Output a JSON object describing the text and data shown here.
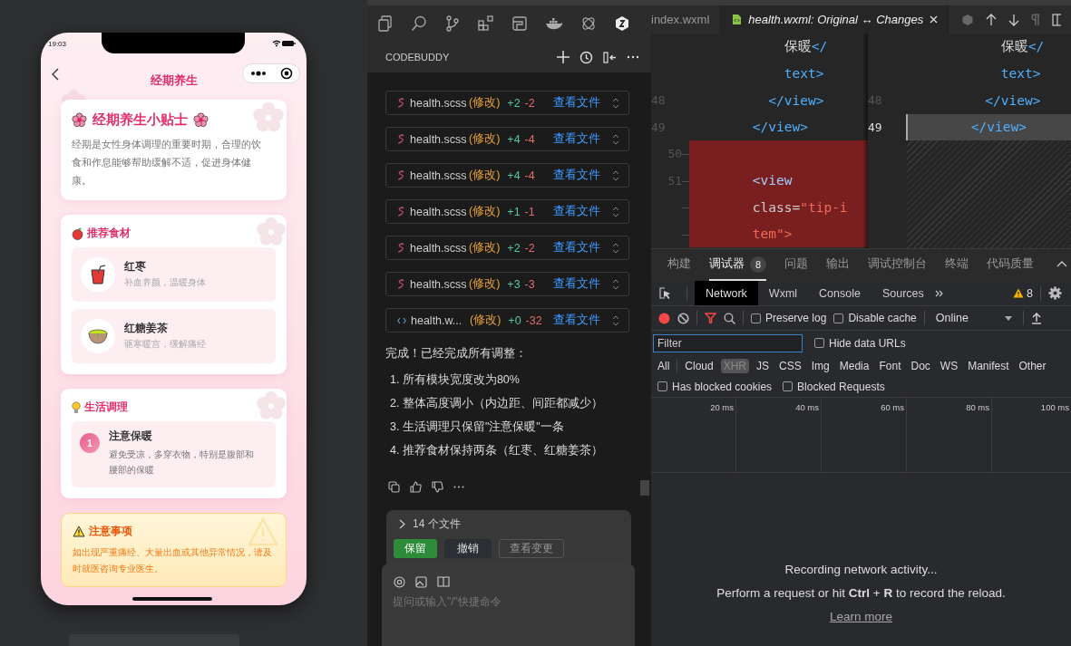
{
  "simulator": {
    "time": "19:03",
    "nav_title": "经期养生",
    "intro": {
      "title": "经期养生小贴士",
      "text": "经期是女性身体调理的重要时期，合理的饮食和作息能够帮助缓解不适，促进身体健康。"
    },
    "foods": {
      "title": "推荐食材",
      "items": [
        {
          "kind": "drink",
          "name": "红枣",
          "desc": "补血养颜，温暖身体"
        },
        {
          "kind": "tea",
          "name": "红糖姜茶",
          "desc": "驱寒暖宫，缓解痛经"
        }
      ]
    },
    "lifestyle": {
      "title": "生活调理",
      "items": [
        {
          "number": "1",
          "name": "注意保暖",
          "desc": "避免受凉，多穿衣物，特别是腹部和腰部的保暖"
        }
      ]
    },
    "notice": {
      "title": "注意事项",
      "text": "如出现严重痛经、大量出血或其他异常情况，请及时就医咨询专业医生。"
    }
  },
  "codebuddy": {
    "title": "CODEBUDDY",
    "files": [
      {
        "kind": "scss",
        "name": "health.scss",
        "status": "(修改)",
        "added": "+2",
        "removed": "-2",
        "action": "查看文件"
      },
      {
        "kind": "scss",
        "name": "health.scss",
        "status": "(修改)",
        "added": "+4",
        "removed": "-4",
        "action": "查看文件"
      },
      {
        "kind": "scss",
        "name": "health.scss",
        "status": "(修改)",
        "added": "+4",
        "removed": "-4",
        "action": "查看文件"
      },
      {
        "kind": "scss",
        "name": "health.scss",
        "status": "(修改)",
        "added": "+1",
        "removed": "-1",
        "action": "查看文件"
      },
      {
        "kind": "scss",
        "name": "health.scss",
        "status": "(修改)",
        "added": "+2",
        "removed": "-2",
        "action": "查看文件"
      },
      {
        "kind": "scss",
        "name": "health.scss",
        "status": "(修改)",
        "added": "+3",
        "removed": "-3",
        "action": "查看文件"
      },
      {
        "kind": "wxml",
        "name": "health.w...",
        "status": "(修改)",
        "added": "+0",
        "removed": "-32",
        "action": "查看文件"
      }
    ],
    "message": {
      "heading": "完成！已经完成所有调整：",
      "items": [
        "1. 所有模块宽度改为80%",
        "2. 整体高度调小（内边距、间距都减少）",
        "3. 生活调理只保留\"注意保暖\"一条",
        "4. 推荐食材保持两条（红枣、红糖姜茶）"
      ]
    },
    "changes": {
      "summary": "14 个文件",
      "expanded": false,
      "buttons": [
        {
          "kind": "primary",
          "label": "保留"
        },
        {
          "kind": "secondary",
          "label": "撤销"
        },
        {
          "kind": "outline",
          "label": "查看变更"
        }
      ]
    },
    "input": {
      "placeholder": "提问或输入\"/\"快捷命令"
    }
  },
  "editor": {
    "tabs": [
      {
        "label": "index.wxml",
        "selected": false
      },
      {
        "label": "health.wxml: Original ↔ Changes",
        "selected": true
      }
    ],
    "original": [
      {
        "kind": "context",
        "tokens": [
          {
            "text": "            保暖",
            "kind": "text"
          },
          {
            "text": "</",
            "kind": "tag"
          }
        ]
      },
      {
        "kind": "context",
        "tokens": [
          {
            "text": "            text>",
            "kind": "tag"
          }
        ]
      },
      {
        "gutter": "48",
        "kind": "context",
        "tokens": [
          {
            "text": "          </view>",
            "kind": "tag"
          }
        ]
      },
      {
        "gutter": "49",
        "kind": "context",
        "tokens": [
          {
            "text": "        </view>",
            "kind": "tag"
          }
        ]
      },
      {
        "gutter": "50—",
        "kind": "removed"
      },
      {
        "gutter": "51—",
        "kind": "removed",
        "tokens": [
          {
            "text": "        <view",
            "kind": "tag"
          }
        ]
      },
      {
        "gutter": "—",
        "kind": "removed",
        "tokens": [
          {
            "text": "        class=",
            "kind": "attr"
          },
          {
            "text": "\"tip-i",
            "kind": "string"
          }
        ]
      },
      {
        "gutter": "—",
        "kind": "removed",
        "tokens": [
          {
            "text": "        tem\">",
            "kind": "string"
          }
        ]
      }
    ],
    "modified": [
      {
        "kind": "context",
        "tokens": [
          {
            "text": "            保暖",
            "kind": "text"
          },
          {
            "text": "</",
            "kind": "tag"
          }
        ]
      },
      {
        "kind": "context",
        "tokens": [
          {
            "text": "            text>",
            "kind": "tag"
          }
        ]
      },
      {
        "gutter": "48",
        "kind": "context",
        "tokens": [
          {
            "text": "          </view>",
            "kind": "tag"
          }
        ]
      },
      {
        "gutter": "49",
        "kind": "current",
        "tokens": [
          {
            "text": "        </view>",
            "kind": "tag"
          }
        ]
      }
    ]
  },
  "devtools": {
    "panel_tabs": [
      {
        "label": "构建",
        "selected": false
      },
      {
        "label": "调试器",
        "selected": true,
        "badge": "8"
      },
      {
        "label": "问题",
        "selected": false
      },
      {
        "label": "输出",
        "selected": false
      },
      {
        "label": "调试控制台",
        "selected": false
      },
      {
        "label": "终端",
        "selected": false
      },
      {
        "label": "代码质量",
        "selected": false
      }
    ],
    "tool_tabs": [
      {
        "label": "Network",
        "selected": true
      },
      {
        "label": "Wxml",
        "selected": false
      },
      {
        "label": "Console",
        "selected": false
      },
      {
        "label": "Sources",
        "selected": false
      }
    ],
    "warnings": "8",
    "options": [
      {
        "label": "Preserve log",
        "checked": false
      },
      {
        "label": "Disable cache",
        "checked": false
      }
    ],
    "throttling": "Online",
    "filter": {
      "placeholder": "Filter"
    },
    "hide_data_urls": {
      "label": "Hide data URLs",
      "checked": false
    },
    "types": [
      {
        "label": "All",
        "selected": false
      },
      {
        "label": "Cloud",
        "selected": false
      },
      {
        "label": "XHR",
        "selected": true
      },
      {
        "label": "JS",
        "selected": false
      },
      {
        "label": "CSS",
        "selected": false
      },
      {
        "label": "Img",
        "selected": false
      },
      {
        "label": "Media",
        "selected": false
      },
      {
        "label": "Font",
        "selected": false
      },
      {
        "label": "Doc",
        "selected": false
      },
      {
        "label": "WS",
        "selected": false
      },
      {
        "label": "Manifest",
        "selected": false
      },
      {
        "label": "Other",
        "selected": false
      }
    ],
    "blocked": [
      {
        "label": "Has blocked cookies",
        "checked": false
      },
      {
        "label": "Blocked Requests",
        "checked": false
      }
    ],
    "ticks": [
      "20 ms",
      "40 ms",
      "60 ms",
      "80 ms",
      "100 ms"
    ],
    "empty": {
      "title": "Recording network activity...",
      "hint": "Perform a request or hit **Ctrl** + **R** to record the reload.",
      "link": "Learn more"
    }
  }
}
